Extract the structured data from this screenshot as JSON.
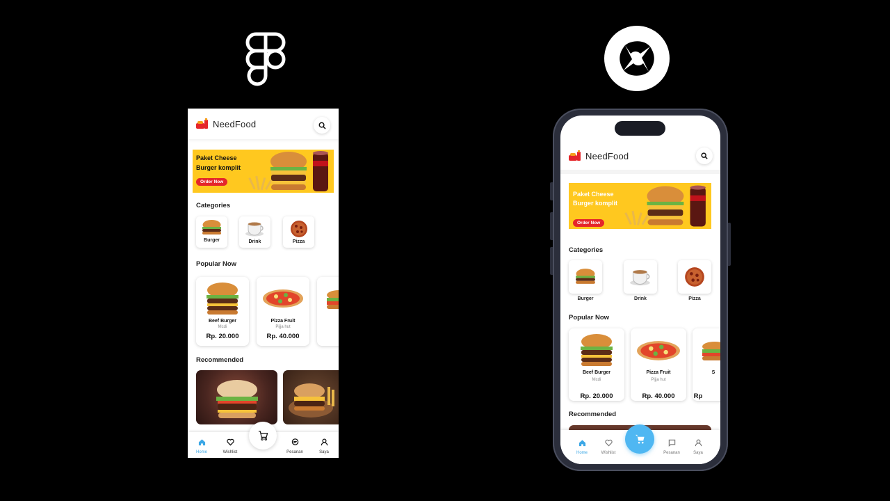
{
  "app": {
    "brand": "NeedFood",
    "banner": {
      "line1": "Paket Cheese",
      "line2": "Burger komplit",
      "cta": "Order Now"
    },
    "sections": {
      "categories": "Categories",
      "popular": "Popular Now",
      "recommended": "Recommended"
    },
    "categories": [
      {
        "label": "Burger",
        "icon": "burger-icon"
      },
      {
        "label": "Drink",
        "icon": "coffee-icon"
      },
      {
        "label": "Pizza",
        "icon": "pizza-icon"
      }
    ],
    "popular": [
      {
        "name": "Beef Burger",
        "store": "Mcdi",
        "price": "Rp. 20.000",
        "icon": "burger-icon"
      },
      {
        "name": "Pizza Fruit",
        "store": "Pijja hut",
        "price": "Rp. 40.000",
        "icon": "pizza-icon"
      },
      {
        "name": "Sa",
        "store": "",
        "price": "Rp.",
        "icon": "sandwich-icon"
      }
    ],
    "popular_phone_third": {
      "name": "S",
      "price": "Rp"
    },
    "nav": [
      {
        "label": "Home",
        "icon": "home-icon",
        "active": true
      },
      {
        "label": "Wishlist",
        "icon": "heart-icon",
        "active": false
      },
      {
        "label": "Pesanan",
        "icon": "chat-icon",
        "active": false
      },
      {
        "label": "Saya",
        "icon": "user-icon",
        "active": false
      }
    ],
    "cart_icon": "cart-icon"
  },
  "logos": {
    "left": "figma-logo",
    "right": "sketch-style-logo"
  },
  "colors": {
    "accent": "#3BA7E6",
    "banner": "#FFC81F",
    "cta": "#E5262A",
    "phone_frame": "#2B2E3B",
    "background": "#000000"
  }
}
